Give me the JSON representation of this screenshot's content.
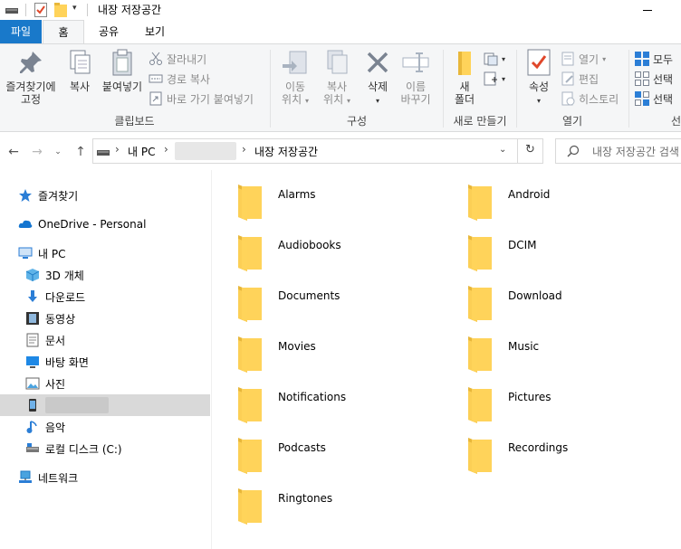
{
  "window": {
    "title": "내장 저장공간"
  },
  "ribbon_tabs": {
    "file": "파일",
    "home": "홈",
    "share": "공유",
    "view": "보기"
  },
  "clipboard": {
    "pin": "즐겨찾기에",
    "pin2": "고정",
    "copy": "복사",
    "paste": "붙여넣기",
    "cut": "잘라내기",
    "copy_path": "경로 복사",
    "paste_shortcut": "바로 가기 붙여넣기",
    "group_label": "클립보드"
  },
  "organize": {
    "move_to": "이동",
    "move_to2": "위치",
    "copy_to": "복사",
    "copy_to2": "위치",
    "delete": "삭제",
    "rename": "이름",
    "rename2": "바꾸기",
    "group_label": "구성"
  },
  "new": {
    "new_folder": "새",
    "new_folder2": "폴더",
    "group_label": "새로 만들기"
  },
  "open": {
    "properties": "속성",
    "open": "열기",
    "edit": "편집",
    "history": "히스토리",
    "group_label": "열기"
  },
  "select": {
    "select_all": "모두",
    "select_none": "선택",
    "invert": "선택",
    "group_label": "선"
  },
  "address": {
    "crumb_pc": "내 PC",
    "crumb_current": "내장 저장공간",
    "search_placeholder": "내장 저장공간 검색"
  },
  "nav": {
    "quick_access": "즐겨찾기",
    "onedrive": "OneDrive - Personal",
    "this_pc": "내 PC",
    "objects3d": "3D 개체",
    "downloads": "다운로드",
    "videos": "동영상",
    "documents": "문서",
    "desktop": "바탕 화면",
    "pictures": "사진",
    "music": "음악",
    "local_disk": "로컬 디스크 (C:)",
    "network": "네트워크"
  },
  "folders": [
    "Alarms",
    "Android",
    "Audiobooks",
    "DCIM",
    "Documents",
    "Download",
    "Movies",
    "Music",
    "Notifications",
    "Pictures",
    "Podcasts",
    "Recordings",
    "Ringtones"
  ],
  "colors": {
    "file_tab": "#1979ca",
    "folder": "#ffd35a",
    "folder_dark": "#e8b73a",
    "selected_nav": "#d9d9d9"
  }
}
